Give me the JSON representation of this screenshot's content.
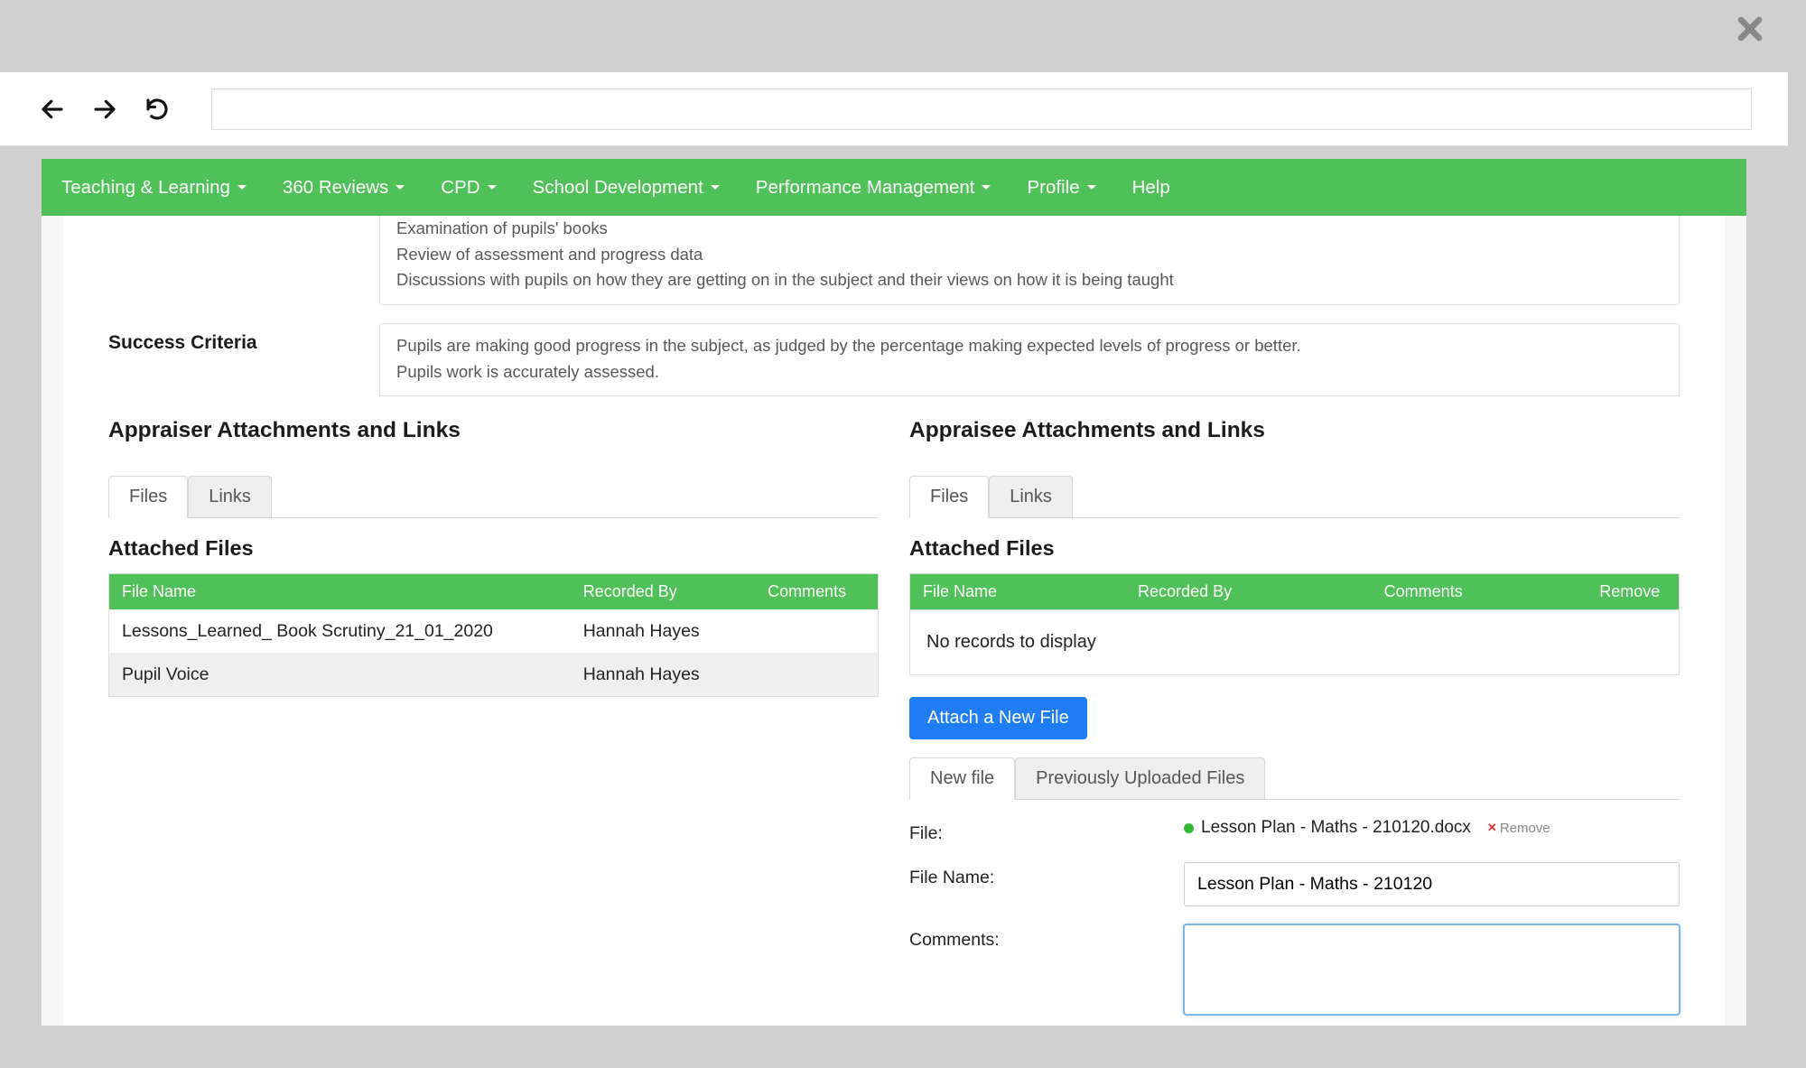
{
  "nav": {
    "items": [
      "Teaching & Learning",
      "360 Reviews",
      "CPD",
      "School Development",
      "Performance Management",
      "Profile",
      "Help"
    ]
  },
  "evaluation": {
    "line1": "Examination of pupils' books",
    "line2": "Review of assessment and progress data",
    "line3": "Discussions with pupils on how they are getting on in the subject and their views on how it is being taught"
  },
  "success_criteria": {
    "label": "Success Criteria",
    "line1": "Pupils are making good progress in the subject, as judged by the percentage making expected levels of progress or better.",
    "line2": "Pupils work is accurately assessed."
  },
  "left": {
    "heading": "Appraiser Attachments and Links",
    "tabs": {
      "files": "Files",
      "links": "Links"
    },
    "sub_heading": "Attached Files",
    "columns": {
      "file_name": "File Name",
      "recorded_by": "Recorded By",
      "comments": "Comments"
    },
    "rows": [
      {
        "file_name": "Lessons_Learned_ Book Scrutiny_21_01_2020",
        "recorded_by": "Hannah Hayes",
        "comments": ""
      },
      {
        "file_name": "Pupil Voice",
        "recorded_by": "Hannah Hayes",
        "comments": ""
      }
    ]
  },
  "right": {
    "heading": "Appraisee Attachments and Links",
    "tabs": {
      "files": "Files",
      "links": "Links"
    },
    "sub_heading": "Attached Files",
    "columns": {
      "file_name": "File Name",
      "recorded_by": "Recorded By",
      "comments": "Comments",
      "remove": "Remove"
    },
    "no_records": "No records to display",
    "attach_button": "Attach a New File",
    "file_tabs": {
      "new": "New file",
      "prev": "Previously Uploaded Files"
    },
    "form": {
      "file_label": "File:",
      "file_chip": "Lesson Plan - Maths - 210120.docx",
      "remove_text": "Remove",
      "filename_label": "File Name:",
      "filename_value": "Lesson Plan - Maths - 210120",
      "comments_label": "Comments:"
    }
  }
}
